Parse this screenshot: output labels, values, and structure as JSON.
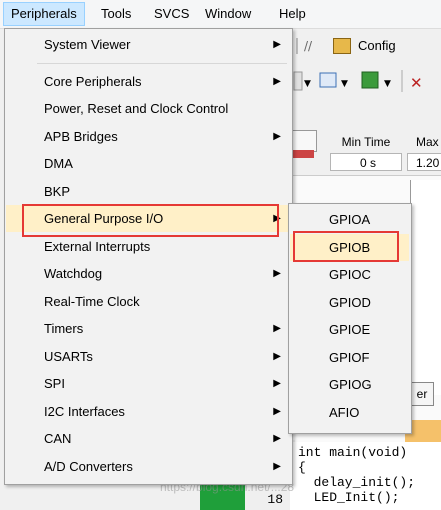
{
  "menubar": {
    "items": [
      {
        "label": "Peripherals"
      },
      {
        "label": "Tools"
      },
      {
        "label": "SVCS"
      },
      {
        "label": "Window"
      },
      {
        "label": "Help"
      }
    ]
  },
  "background": {
    "config_label": "Config",
    "min_time_header": "Min Time",
    "max_time_header": "Max",
    "min_time_value": "0 s",
    "max_time_value": "1.20",
    "partial_button": "er",
    "line_number": "18",
    "code_lines": [
      "int main(void)",
      "{",
      "  delay_init();",
      "  LED_Init();"
    ],
    "watermark": "https://blog.csdn.net/...28"
  },
  "peripherals_menu": {
    "items": [
      {
        "label": "System Viewer",
        "submenu": true
      },
      {
        "label": "Core Peripherals",
        "submenu": true
      },
      {
        "label": "Power, Reset and Clock Control",
        "submenu": false
      },
      {
        "label": "APB Bridges",
        "submenu": true
      },
      {
        "label": "DMA",
        "submenu": false
      },
      {
        "label": "BKP",
        "submenu": false
      },
      {
        "label": "General Purpose I/O",
        "submenu": true
      },
      {
        "label": "External Interrupts",
        "submenu": false
      },
      {
        "label": "Watchdog",
        "submenu": true
      },
      {
        "label": "Real-Time Clock",
        "submenu": false
      },
      {
        "label": "Timers",
        "submenu": true
      },
      {
        "label": "USARTs",
        "submenu": true
      },
      {
        "label": "SPI",
        "submenu": true
      },
      {
        "label": "I2C Interfaces",
        "submenu": true
      },
      {
        "label": "CAN",
        "submenu": true
      },
      {
        "label": "A/D Converters",
        "submenu": true
      }
    ],
    "highlighted": "General Purpose I/O"
  },
  "gpio_submenu": {
    "items": [
      {
        "label": "GPIOA"
      },
      {
        "label": "GPIOB"
      },
      {
        "label": "GPIOC"
      },
      {
        "label": "GPIOD"
      },
      {
        "label": "GPIOE"
      },
      {
        "label": "GPIOF"
      },
      {
        "label": "GPIOG"
      },
      {
        "label": "AFIO"
      }
    ],
    "highlighted": "GPIOB"
  },
  "colors": {
    "highlight": "#fff0c8",
    "annotation_red": "#e53935",
    "menubar_active": "#cce8ff"
  },
  "icons": {
    "submenu_arrow": "triangle-right-icon",
    "config": "config-folder-icon"
  }
}
